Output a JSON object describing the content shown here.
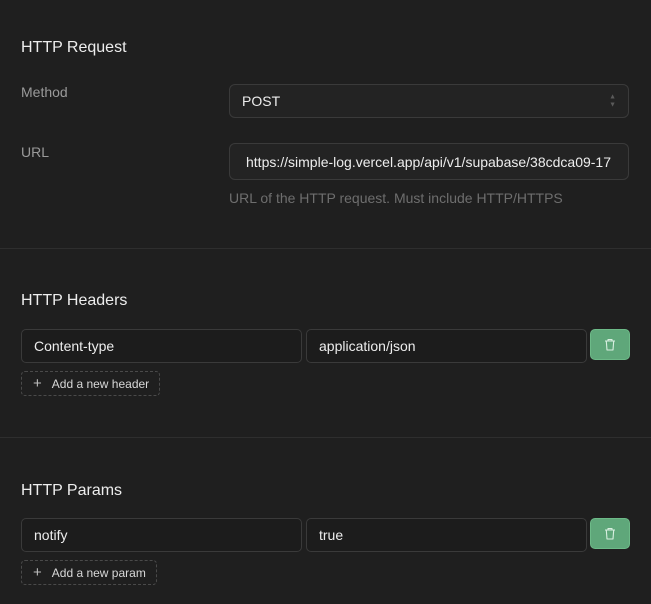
{
  "request": {
    "title": "HTTP Request",
    "method_label": "Method",
    "method_value": "POST",
    "url_label": "URL",
    "url_value": "https://simple-log.vercel.app/api/v1/supabase/38cdca09-17",
    "url_help": "URL of the HTTP request. Must include HTTP/HTTPS"
  },
  "headers": {
    "title": "HTTP Headers",
    "rows": [
      {
        "key": "Content-type",
        "value": "application/json"
      }
    ],
    "add_label": "Add a new header"
  },
  "params": {
    "title": "HTTP Params",
    "rows": [
      {
        "key": "notify",
        "value": "true"
      }
    ],
    "add_label": "Add a new param"
  },
  "colors": {
    "background": "#1f1f1f",
    "delete_button": "#5fa77a",
    "divider": "#2e2e2e"
  },
  "icons": {
    "delete": "trash-icon",
    "add": "plus-icon",
    "select": "chevron-updown-icon"
  }
}
